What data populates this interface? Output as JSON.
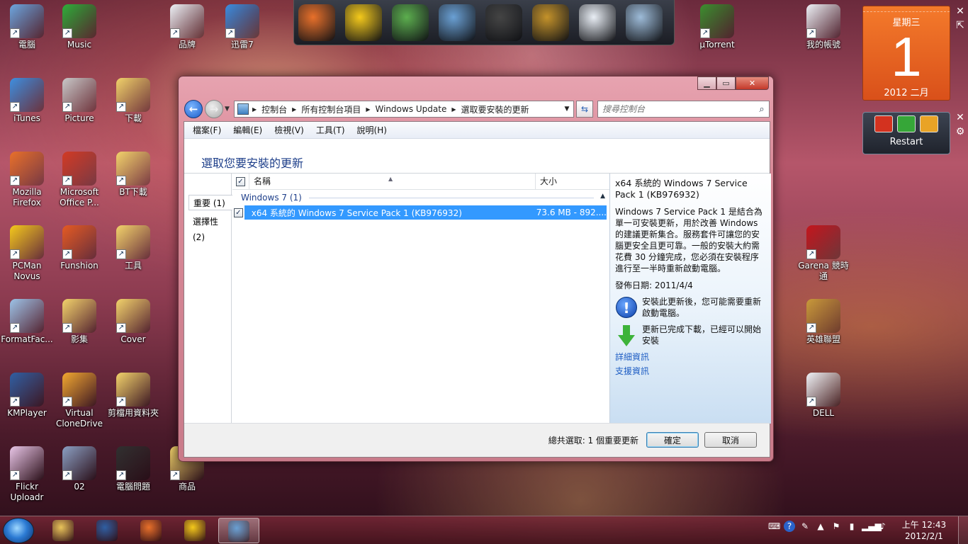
{
  "desktop": {
    "icons": [
      {
        "label": "電腦",
        "color": "#6ea6e0"
      },
      {
        "label": "Music",
        "color": "#2fae3a"
      },
      {
        "label": "品牌",
        "color": "#eef2f7"
      },
      {
        "label": "迅雷7",
        "color": "#3b8de0"
      },
      {
        "label": "µTorrent",
        "color": "#3c8f2f"
      },
      {
        "label": "我的帳號",
        "color": "#eef2f7"
      },
      {
        "label": "iTunes",
        "color": "#3f8fe0"
      },
      {
        "label": "Picture",
        "color": "#c9c9c9"
      },
      {
        "label": "下載",
        "color": "#f2d36b"
      },
      {
        "label": "Mozilla Firefox",
        "color": "#e8702a"
      },
      {
        "label": "Microsoft Office P...",
        "color": "#d23a24"
      },
      {
        "label": "BT下載",
        "color": "#f2d36b"
      },
      {
        "label": "PCMan Novus",
        "color": "#f4c91b"
      },
      {
        "label": "Funshion",
        "color": "#e45a22"
      },
      {
        "label": "工具",
        "color": "#f2d36b"
      },
      {
        "label": "Garena 競時通",
        "color": "#c4161c"
      },
      {
        "label": "FormatFac...",
        "color": "#9cc3e8"
      },
      {
        "label": "影集",
        "color": "#f2d36b"
      },
      {
        "label": "Cover",
        "color": "#f2d36b"
      },
      {
        "label": "英雄聯盟",
        "color": "#c99a3a"
      },
      {
        "label": "KMPlayer",
        "color": "#2f5fa3"
      },
      {
        "label": "Virtual CloneDrive",
        "color": "#f2a830"
      },
      {
        "label": "剪檔用資料夾",
        "color": "#f2d36b"
      },
      {
        "label": "DELL",
        "color": "#eef2f7"
      },
      {
        "label": "Flickr Uploadr",
        "color": "#e9c6e8"
      },
      {
        "label": "02",
        "color": "#8ba0c4"
      },
      {
        "label": "電腦問題",
        "color": "#303030"
      },
      {
        "label": "商品",
        "color": "#f2d36b"
      }
    ],
    "dock_icons": [
      "firefox-icon",
      "pcman-icon",
      "mail-icon",
      "photo-icon",
      "film-reel-icon",
      "padlock-icon",
      "help-icon",
      "recycle-bin-icon"
    ]
  },
  "calendar_gadget": {
    "weekday": "星期三",
    "day": "1",
    "year_month": "2012 二月"
  },
  "restart_gadget": {
    "label": "Restart"
  },
  "window": {
    "address": {
      "crumbs": [
        "控制台",
        "所有控制台項目",
        "Windows Update",
        "選取要安裝的更新"
      ]
    },
    "search": {
      "placeholder": "搜尋控制台"
    },
    "menu": [
      "檔案(F)",
      "編輯(E)",
      "檢視(V)",
      "工具(T)",
      "說明(H)"
    ],
    "page_title": "選取您要安裝的更新",
    "categories": [
      {
        "label": "重要 (1)",
        "selected": true
      },
      {
        "label": "選擇性 (2)",
        "selected": false
      }
    ],
    "columns": {
      "name": "名稱",
      "size": "大小"
    },
    "group": {
      "label": "Windows 7 (1)"
    },
    "rows": [
      {
        "checked": "✓",
        "name": "x64 系統的 Windows 7 Service Pack 1 (KB976932)",
        "size": "73.6 MB - 892...."
      }
    ],
    "detail": {
      "title": "x64 系統的 Windows 7 Service Pack 1 (KB976932)",
      "description": "Windows 7 Service Pack 1 是結合為單一可安裝更新，用於改善 Windows 的建議更新集合。服務套件可讓您的安腦更安全且更可靠。一般的安裝大約需花費 30 分鐘完成，您必須在安裝程序進行至一半時重新啟動電腦。",
      "publish_date": "發佈日期:  2011/4/4",
      "restart_note": "安裝此更新後，您可能需要重新啟動電腦。",
      "download_note": "更新已完成下載，已經可以開始安裝",
      "more_info": "詳細資訊",
      "support_info": "支援資訊"
    },
    "footer": {
      "summary": "總共選取: 1 個重要更新",
      "ok": "確定",
      "cancel": "取消"
    }
  },
  "taskbar": {
    "items": [
      "explorer-icon",
      "kmplayer-icon",
      "firefox-icon",
      "pcman-icon",
      "control-panel-icon"
    ],
    "clock_time": "上午 12:43",
    "clock_date": "2012/2/1"
  }
}
